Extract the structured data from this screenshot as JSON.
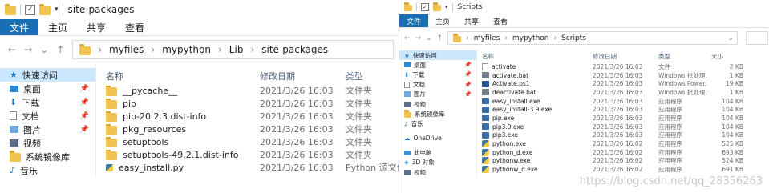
{
  "left_window": {
    "title": "site-packages",
    "ribbon_tabs": [
      "文件",
      "主页",
      "共享",
      "查看"
    ],
    "breadcrumb": [
      "myfiles",
      "mypython",
      "Lib",
      "site-packages"
    ],
    "sidebar": [
      {
        "label": "快速访问",
        "icon": "star-icon",
        "pinned": false
      },
      {
        "label": "桌面",
        "icon": "desktop-icon",
        "pinned": true
      },
      {
        "label": "下载",
        "icon": "download-icon",
        "pinned": true
      },
      {
        "label": "文档",
        "icon": "document-icon",
        "pinned": true
      },
      {
        "label": "图片",
        "icon": "picture-icon",
        "pinned": true
      },
      {
        "label": "视频",
        "icon": "video-icon",
        "pinned": false
      },
      {
        "label": "系统镜像库",
        "icon": "folder-icon",
        "pinned": false
      },
      {
        "label": "音乐",
        "icon": "music-icon",
        "pinned": false
      }
    ],
    "columns": [
      "名称",
      "修改日期",
      "类型"
    ],
    "files": [
      {
        "name": "__pycache__",
        "date": "2021/3/26 16:03",
        "type": "文件夹",
        "icon": "folder-icon"
      },
      {
        "name": "pip",
        "date": "2021/3/26 16:03",
        "type": "文件夹",
        "icon": "folder-icon"
      },
      {
        "name": "pip-20.2.3.dist-info",
        "date": "2021/3/26 16:03",
        "type": "文件夹",
        "icon": "folder-icon"
      },
      {
        "name": "pkg_resources",
        "date": "2021/3/26 16:03",
        "type": "文件夹",
        "icon": "folder-icon"
      },
      {
        "name": "setuptools",
        "date": "2021/3/26 16:03",
        "type": "文件夹",
        "icon": "folder-icon"
      },
      {
        "name": "setuptools-49.2.1.dist-info",
        "date": "2021/3/26 16:03",
        "type": "文件夹",
        "icon": "folder-icon"
      },
      {
        "name": "easy_install.py",
        "date": "2021/3/26 16:03",
        "type": "Python 源文件",
        "icon": "python-file-icon"
      }
    ]
  },
  "right_window": {
    "title": "Scripts",
    "ribbon_tabs": [
      "文件",
      "主页",
      "共享",
      "查看"
    ],
    "breadcrumb": [
      "myfiles",
      "mypython",
      "Scripts"
    ],
    "sidebar": [
      {
        "label": "快速访问",
        "icon": "star-icon",
        "pinned": false
      },
      {
        "label": "桌面",
        "icon": "desktop-icon",
        "pinned": true
      },
      {
        "label": "下载",
        "icon": "download-icon",
        "pinned": true
      },
      {
        "label": "文档",
        "icon": "document-icon",
        "pinned": true
      },
      {
        "label": "图片",
        "icon": "picture-icon",
        "pinned": true
      },
      {
        "label": "视频",
        "icon": "video-icon",
        "pinned": false
      },
      {
        "label": "系统镜像库",
        "icon": "folder-icon",
        "pinned": false
      },
      {
        "label": "音乐",
        "icon": "music-icon",
        "pinned": false
      },
      {
        "label": "OneDrive",
        "icon": "cloud-icon",
        "pinned": false
      },
      {
        "label": "此电脑",
        "icon": "computer-icon",
        "pinned": false
      },
      {
        "label": "3D 对象",
        "icon": "cube-icon",
        "pinned": false
      },
      {
        "label": "视频",
        "icon": "video-icon",
        "pinned": false
      }
    ],
    "columns": [
      "名称",
      "修改日期",
      "类型",
      "大小"
    ],
    "files": [
      {
        "name": "activate",
        "date": "2021/3/26 16:03",
        "type": "文件",
        "size": "2 KB",
        "icon": "file-icon"
      },
      {
        "name": "activate.bat",
        "date": "2021/3/26 16:03",
        "type": "Windows 批处理...",
        "size": "1 KB",
        "icon": "bat-icon"
      },
      {
        "name": "Activate.ps1",
        "date": "2021/3/26 16:03",
        "type": "Windows Power...",
        "size": "19 KB",
        "icon": "powershell-icon"
      },
      {
        "name": "deactivate.bat",
        "date": "2021/3/26 16:03",
        "type": "Windows 批处理...",
        "size": "1 KB",
        "icon": "bat-icon"
      },
      {
        "name": "easy_install.exe",
        "date": "2021/3/26 16:03",
        "type": "应用程序",
        "size": "104 KB",
        "icon": "exe-icon"
      },
      {
        "name": "easy_install-3.9.exe",
        "date": "2021/3/26 16:03",
        "type": "应用程序",
        "size": "104 KB",
        "icon": "exe-icon"
      },
      {
        "name": "pip.exe",
        "date": "2021/3/26 16:03",
        "type": "应用程序",
        "size": "104 KB",
        "icon": "exe-icon"
      },
      {
        "name": "pip3.9.exe",
        "date": "2021/3/26 16:03",
        "type": "应用程序",
        "size": "104 KB",
        "icon": "exe-icon"
      },
      {
        "name": "pip3.exe",
        "date": "2021/3/26 16:03",
        "type": "应用程序",
        "size": "104 KB",
        "icon": "exe-icon"
      },
      {
        "name": "python.exe",
        "date": "2021/3/26 16:02",
        "type": "应用程序",
        "size": "525 KB",
        "icon": "python-icon"
      },
      {
        "name": "python_d.exe",
        "date": "2021/3/26 16:02",
        "type": "应用程序",
        "size": "693 KB",
        "icon": "python-icon"
      },
      {
        "name": "pythonw.exe",
        "date": "2021/3/26 16:02",
        "type": "应用程序",
        "size": "524 KB",
        "icon": "python-icon"
      },
      {
        "name": "pythonw_d.exe",
        "date": "2021/3/26 16:02",
        "type": "应用程序",
        "size": "691 KB",
        "icon": "python-icon"
      }
    ]
  },
  "watermark": "https://blog.csdn.net/qq_28356263",
  "colors": {
    "accent": "#1a6fb4",
    "selection": "#cce8ff",
    "folder": "#f0c350"
  }
}
